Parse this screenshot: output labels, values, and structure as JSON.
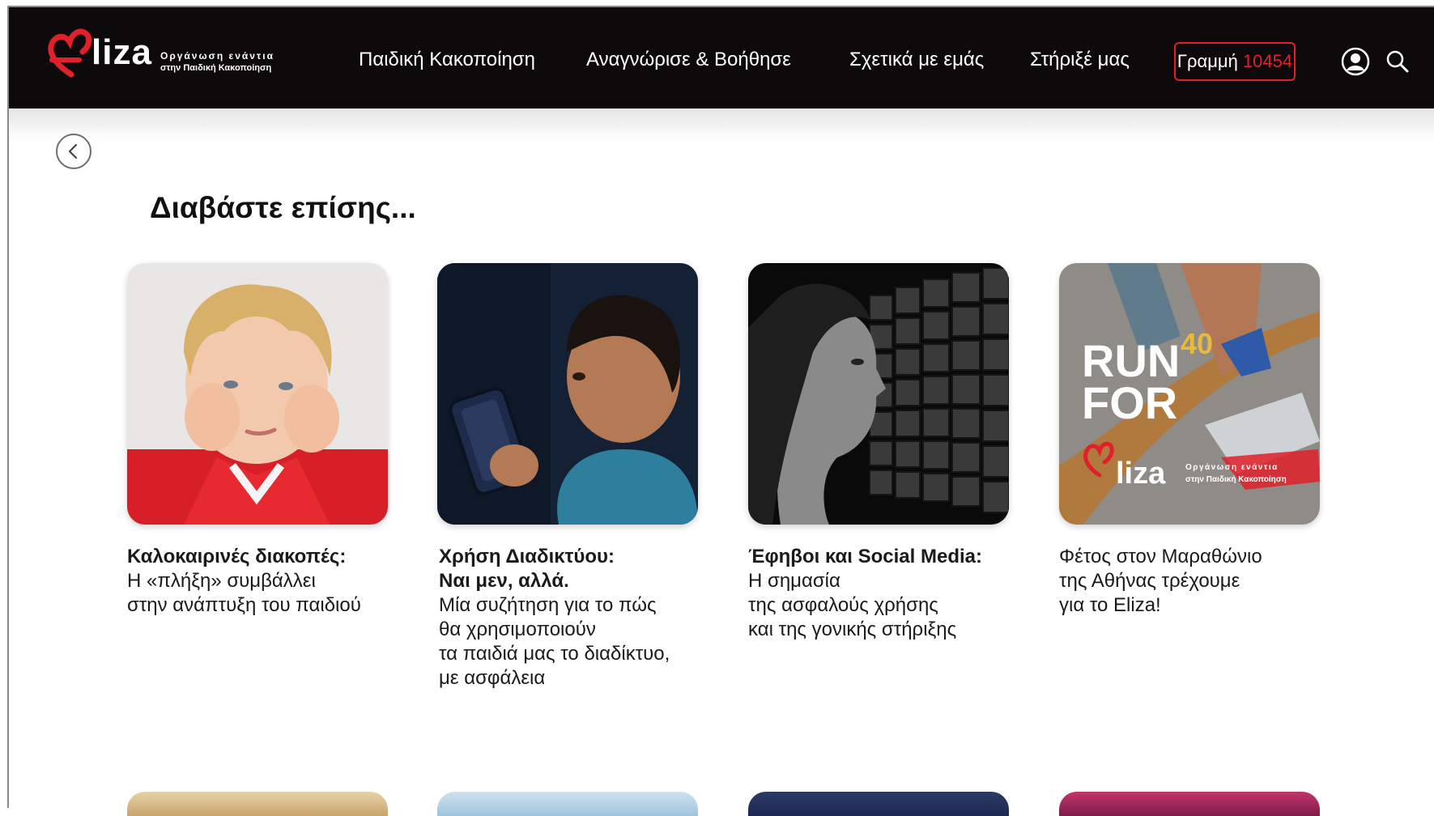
{
  "brand": {
    "logo_text": "liza",
    "tagline_line1": "Οργάνωση ενάντια",
    "tagline_line2": "στην Παιδική Κακοποίηση",
    "accent_color": "#e0202a",
    "header_bg": "#0e0a0b"
  },
  "nav": {
    "items": [
      {
        "label": "Παιδική Κακοποίηση"
      },
      {
        "label": "Αναγνώρισε & Βοήθησε"
      },
      {
        "label": "Σχετικά με εμάς"
      },
      {
        "label": "Στήριξέ μας"
      }
    ],
    "hotline_label": "Γραμμή",
    "hotline_number": "10454",
    "account_icon": "user-circle-icon",
    "search_icon": "search-icon"
  },
  "back_icon": "chevron-left-icon",
  "section_title": "Διαβάστε επίσης...",
  "cards": [
    {
      "title": "Καλοκαιρινές διακοπές:",
      "description": "Η «πλήξη» συμβάλλει\nστην ανάπτυξη του παιδιού"
    },
    {
      "title": "Χρήση Διαδικτύου:\nΝαι μεν, αλλά.",
      "description": "Μία συζήτηση για το πώς\nθα χρησιμοποιούν\nτα παιδιά μας το διαδίκτυο,\nμε ασφάλεια"
    },
    {
      "title": "Έφηβοι και Social Media:",
      "description": "Η σημασία\nτης ασφαλούς χρήσης\nκαι της γονικής στήριξης"
    },
    {
      "title": "Φέτος στον Μαραθώνιο\nτης Αθήνας τρέχουμε\nγια το Eliza!",
      "description": "",
      "image_text_line1": "RUN",
      "image_text_line2": "FOR",
      "image_logo_text": "liza",
      "image_tagline1": "Οργάνωση ενάντια",
      "image_tagline2": "στην Παιδική Κακοποίηση",
      "image_badge": "40"
    }
  ]
}
